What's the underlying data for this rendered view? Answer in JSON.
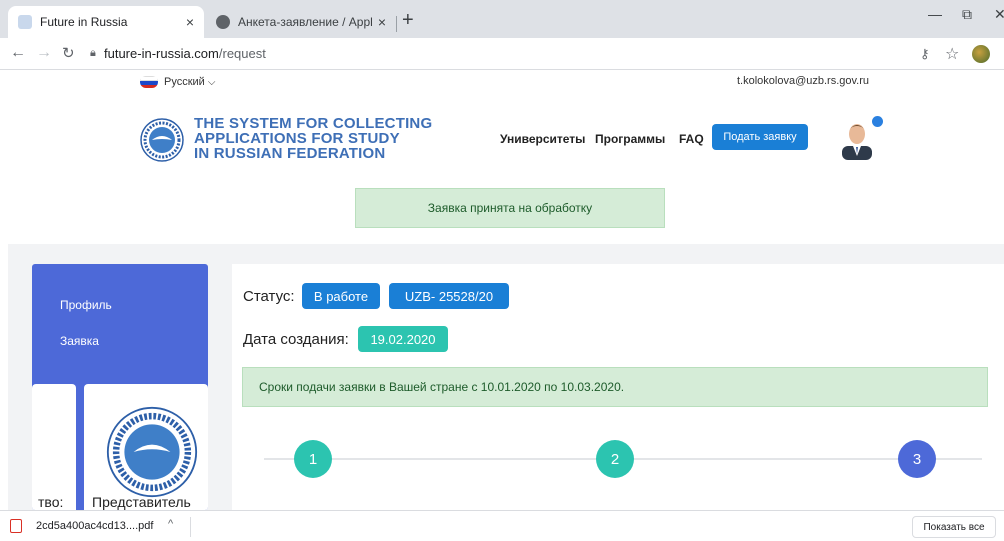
{
  "browser": {
    "tabs": [
      {
        "title": "Future in Russia",
        "close": "×"
      },
      {
        "title": "Анкета-заявление / Application",
        "close": "×"
      }
    ],
    "new_tab": "+",
    "url_host": "future-in-russia.com",
    "url_path": "/request",
    "controls": {
      "minimize": "—",
      "restore": "⧉",
      "close": "✕"
    }
  },
  "header": {
    "language": "Русский",
    "language_chevron": "⌵",
    "user_email": "t.kolokolova@uzb.rs.gov.ru",
    "brand_lines": [
      "THE SYSTEM FOR COLLECTING",
      "APPLICATIONS FOR STUDY",
      "IN RUSSIAN FEDERATION"
    ],
    "nav": [
      "Университеты",
      "Программы",
      "FAQ"
    ],
    "apply_button": "Подать заявку"
  },
  "notice": "Заявка принята на обработку",
  "sidebar": {
    "items": [
      "Профиль",
      "Заявка"
    ],
    "card_left_text": "тво:",
    "card_right_text": "Представитель"
  },
  "application": {
    "status_label": "Статус:",
    "status_value": "В работе",
    "id_value": "UZB- 25528/20",
    "created_label": "Дата создания:",
    "created_value": "19.02.2020",
    "deadline_notice": "Сроки подачи заявки в Вашей стране с 10.01.2020 по 10.03.2020.",
    "steps": [
      "1",
      "2",
      "3"
    ]
  },
  "download": {
    "file_name": "2cd5a400ac4cd13....pdf",
    "chevron": "^",
    "show_all": "Показать все"
  },
  "colors": {
    "primary": "#1a7fd6",
    "teal": "#2cc4b0",
    "sidebar": "#4d69d8",
    "brand_text": "#3e6fb6",
    "success_bg": "#d5ecd7"
  }
}
